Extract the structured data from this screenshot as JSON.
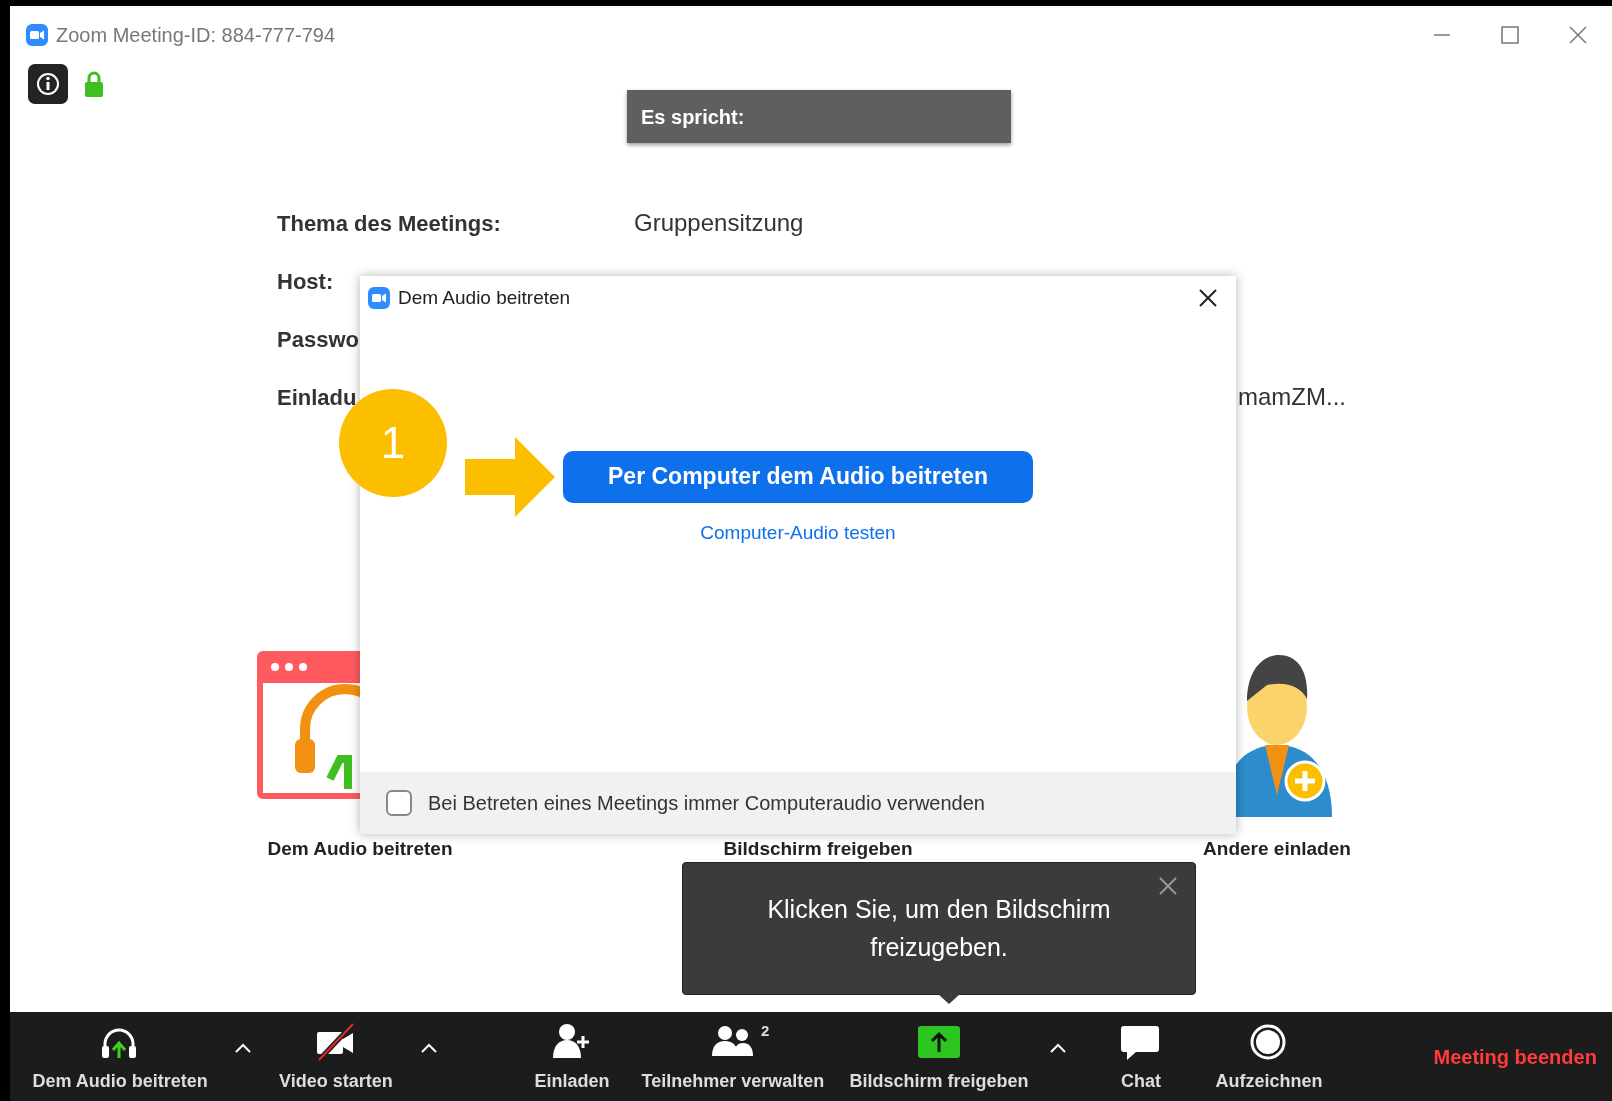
{
  "window": {
    "title": "Zoom Meeting-ID: 884-777-794"
  },
  "speaker_banner": {
    "label": "Es spricht:"
  },
  "meeting_info": [
    {
      "label": "Thema des Meetings:",
      "value": "Gruppensitzung"
    },
    {
      "label": "Host:"
    },
    {
      "label": "Passwo"
    },
    {
      "label": "Einladu",
      "value": "mamZM..."
    }
  ],
  "tiles": [
    {
      "kind": "audio",
      "label": "Dem Audio beitreten"
    },
    {
      "kind": "share",
      "label": "Bildschirm freigeben"
    },
    {
      "kind": "invite",
      "label": "Andere einladen"
    }
  ],
  "dialog": {
    "title": "Dem Audio beitreten",
    "primary_button": "Per Computer dem Audio beitreten",
    "link": "Computer-Audio testen",
    "checkbox": {
      "label": "Bei Betreten eines Meetings immer Computeraudio verwenden",
      "checked": false
    }
  },
  "annotation": {
    "number": "1"
  },
  "tooltip": {
    "text": "Klicken Sie, um den Bildschirm freizugeben."
  },
  "toolbar": [
    {
      "kind": "audio",
      "label": "Dem Audio beitreten"
    },
    {
      "kind": "caret"
    },
    {
      "kind": "video",
      "label": "Video starten",
      "on": false
    },
    {
      "kind": "caret"
    },
    {
      "kind": "invite",
      "label": "Einladen"
    },
    {
      "kind": "participants",
      "label": "Teilnehmer verwalten",
      "count": "2"
    },
    {
      "kind": "share",
      "label": "Bildschirm freigeben"
    },
    {
      "kind": "caret"
    },
    {
      "kind": "chat",
      "label": "Chat"
    },
    {
      "kind": "record",
      "label": "Aufzeichnen"
    },
    {
      "kind": "end",
      "label": "Meeting beenden"
    }
  ]
}
